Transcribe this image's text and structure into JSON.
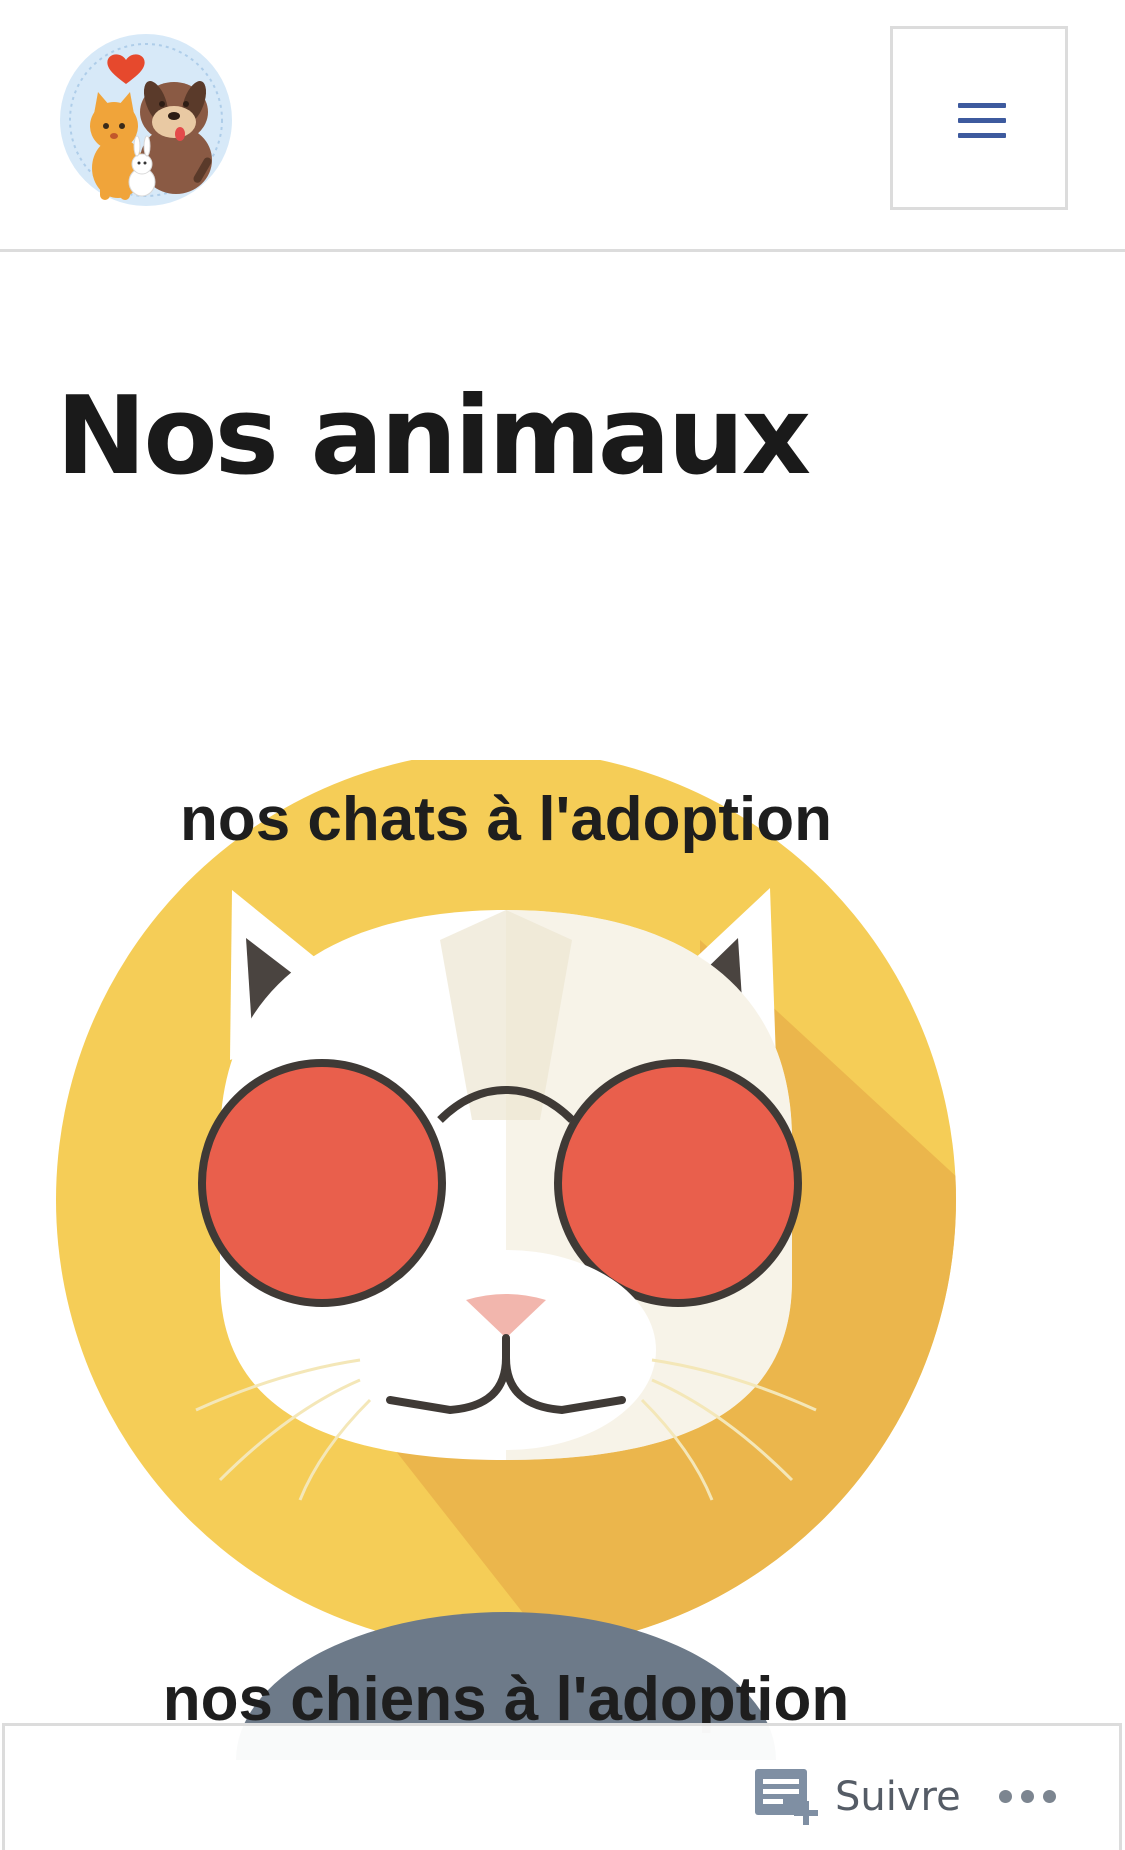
{
  "header": {
    "logo_icon": "cat-dog-rabbit-logo-icon",
    "menu_icon": "hamburger-menu-icon",
    "menu_color": "#3d5a9e"
  },
  "main": {
    "title": "Nos animaux",
    "image": {
      "caption_top": "nos chats à l'adoption",
      "caption_bottom": "nos chiens à l'adoption",
      "colors": {
        "disc": "#f5cd57",
        "lens": "#e95f4c",
        "dog_disc": "#6d7a89"
      }
    }
  },
  "follow_bar": {
    "follow_label": "Suivre",
    "follow_icon": "reader-follow-icon",
    "more_icon": "ellipsis-more-icon"
  }
}
